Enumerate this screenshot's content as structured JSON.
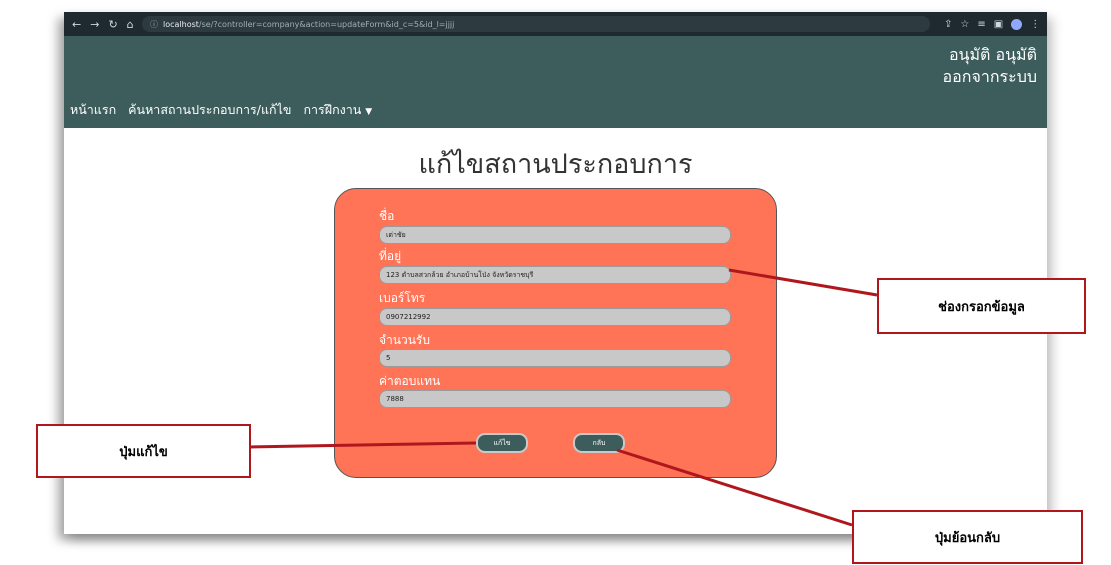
{
  "browser": {
    "url_host": "localhost",
    "url_path": "/se/?controller=company&action=updateForm&id_c=5&id_l=jjjj"
  },
  "nav": {
    "items": [
      "หน้าแรก",
      "ค้นหาสถานประกอบการ/แก้ไข",
      "การฝึกงาน"
    ],
    "user_name": "อนุมัติ อนุมัติ",
    "logout": "ออกจากระบบ"
  },
  "page": {
    "title": "แก้ไขสถานประกอบการ"
  },
  "form": {
    "fields": [
      {
        "label": "ชื่อ",
        "value": "เต่าชัย"
      },
      {
        "label": "ที่อยู่",
        "value": "123 ตำบลสวกล้วย อำเภอบ้านโป่ง จังหวัดราชบุรี"
      },
      {
        "label": "เบอร์โทร",
        "value": "0907212992"
      },
      {
        "label": "จำนวนรับ",
        "value": "5"
      },
      {
        "label": "ค่าตอบแทน",
        "value": "7888"
      }
    ],
    "save_label": "แก้ไข",
    "back_label": "กลับ"
  },
  "callouts": {
    "fields": "ช่องกรอกข้อมูล",
    "edit": "ปุ่มแก้ไข",
    "back": "ปุ่มย้อนกลับ"
  },
  "colors": {
    "navbar": "#3d5c5c",
    "card": "#ff7457",
    "callout_line": "#b0171d"
  }
}
